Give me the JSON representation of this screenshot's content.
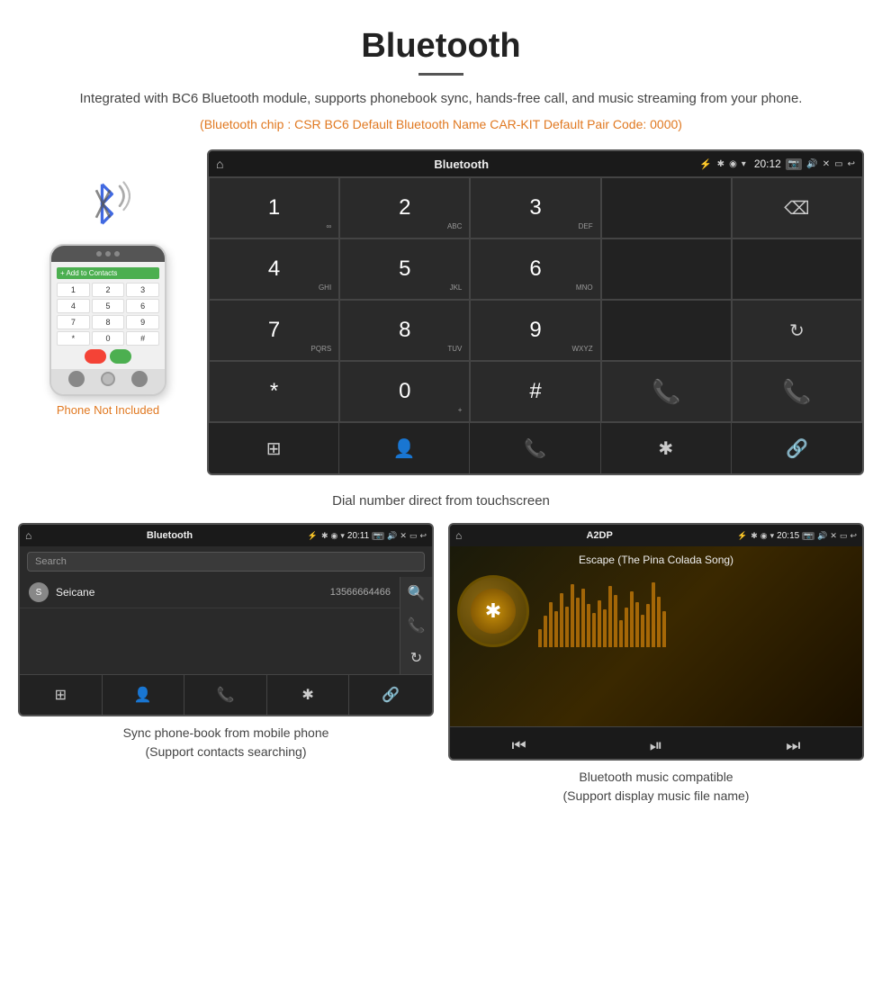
{
  "header": {
    "title": "Bluetooth",
    "description": "Integrated with BC6 Bluetooth module, supports phonebook sync, hands-free call, and music streaming from your phone.",
    "bluetooth_info": "(Bluetooth chip : CSR BC6    Default Bluetooth Name CAR-KIT    Default Pair Code: 0000)"
  },
  "phone_label": "Phone Not Included",
  "dialpad_screen": {
    "status_bar": {
      "home_icon": "⌂",
      "title": "Bluetooth",
      "usb_icon": "⚡",
      "bt_icon": "✱",
      "location_icon": "◉",
      "signal_icon": "▾",
      "time": "20:12",
      "camera_icon": "📷",
      "volume_icon": "🔊",
      "close_icon": "✕",
      "window_icon": "▭",
      "back_icon": "↩"
    },
    "keys": [
      {
        "label": "1",
        "sub": "∞"
      },
      {
        "label": "2",
        "sub": "ABC"
      },
      {
        "label": "3",
        "sub": "DEF"
      },
      {
        "label": "",
        "type": "empty"
      },
      {
        "label": "⌫",
        "type": "backspace"
      },
      {
        "label": "4",
        "sub": "GHI"
      },
      {
        "label": "5",
        "sub": "JKL"
      },
      {
        "label": "6",
        "sub": "MNO"
      },
      {
        "label": "",
        "type": "empty"
      },
      {
        "label": "",
        "type": "empty"
      },
      {
        "label": "7",
        "sub": "PQRS"
      },
      {
        "label": "8",
        "sub": "TUV"
      },
      {
        "label": "9",
        "sub": "WXYZ"
      },
      {
        "label": "",
        "type": "empty"
      },
      {
        "label": "↻",
        "type": "refresh"
      },
      {
        "label": "*",
        "sub": ""
      },
      {
        "label": "0",
        "sub": "+"
      },
      {
        "label": "#",
        "sub": ""
      },
      {
        "label": "📞",
        "type": "call-green"
      },
      {
        "label": "📞",
        "type": "call-red"
      }
    ],
    "bottom_icons": [
      "⊞",
      "👤",
      "📞",
      "✱",
      "🔗"
    ]
  },
  "caption_main": "Dial number direct from touchscreen",
  "phonebook_screen": {
    "title": "Bluetooth",
    "time": "20:11",
    "search_placeholder": "Search",
    "contacts": [
      {
        "letter": "S",
        "name": "Seicane",
        "number": "13566664466"
      }
    ],
    "side_icons": [
      "🔍",
      "📞",
      "↻"
    ],
    "bottom_icons": [
      "⊞",
      "👤",
      "📞",
      "✱",
      "🔗"
    ]
  },
  "music_screen": {
    "title": "A2DP",
    "time": "20:15",
    "song_title": "Escape (The Pina Colada Song)",
    "viz_bars": [
      20,
      35,
      50,
      40,
      60,
      45,
      70,
      55,
      65,
      48,
      38,
      52,
      42,
      68,
      58,
      30,
      44,
      62,
      50,
      36,
      48,
      72,
      56,
      40
    ],
    "controls": [
      "⏮",
      "⏯",
      "⏭"
    ]
  },
  "caption_phonebook": {
    "line1": "Sync phone-book from mobile phone",
    "line2": "(Support contacts searching)"
  },
  "caption_music": {
    "line1": "Bluetooth music compatible",
    "line2": "(Support display music file name)"
  }
}
